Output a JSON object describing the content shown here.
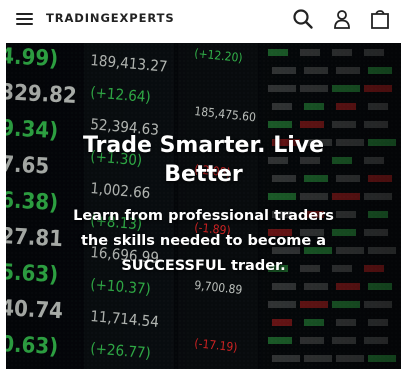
{
  "header": {
    "brand": "TRADINGEXPERTS",
    "icons": [
      "menu-icon",
      "search-icon",
      "account-icon",
      "cart-icon"
    ]
  },
  "hero": {
    "headline_line1": "Trade Smarter. Live",
    "headline_line2": "Better",
    "sub_line1": "Learn from professional traders",
    "sub_line2": "the skills needed to become a",
    "sub_line3": "SUCCESSFUL trader.",
    "board": {
      "columns": [
        [
          "4.99)",
          "329.82",
          "9.34)",
          "7.65",
          "6.38)",
          "27.81",
          "5.63)",
          "40.74",
          "0.63)"
        ],
        [
          "189,413.27",
          "(+12.64)",
          "52,394.63",
          "(+1.30)",
          "1,002.66",
          "(+8.13)",
          "16,696.99",
          "(+10.37)",
          "11,714.54",
          "(+26.77)"
        ],
        [
          "(+12.20)",
          "185,475.60",
          "(-2.08)",
          "(-1.89)",
          "9,700.89",
          "(-17.19)"
        ]
      ],
      "colors": {
        "white": "#e6ebe6",
        "green": "#3ddc5a",
        "red": "#ff2a2a",
        "background": "#05080c"
      }
    }
  }
}
